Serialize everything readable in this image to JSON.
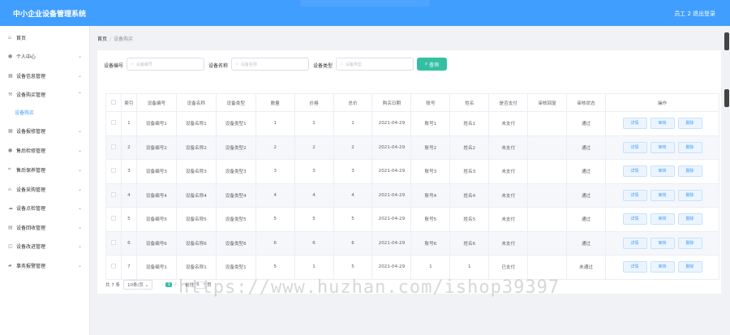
{
  "header": {
    "title": "中小企业设备管理系统",
    "user": "员工 2",
    "logout": "退出登录"
  },
  "sidebar": {
    "items": [
      {
        "label": "首页",
        "icon": "home-icon"
      },
      {
        "label": "个人中心",
        "icon": "user-icon"
      },
      {
        "label": "设备信息管理",
        "icon": "grid-icon"
      },
      {
        "label": "设备购买管理",
        "icon": "hammer-icon"
      },
      {
        "label": "设备购买",
        "icon": ""
      },
      {
        "label": "设备报修管理",
        "icon": "grid-icon"
      },
      {
        "label": "售后检修管理",
        "icon": "user-icon"
      },
      {
        "label": "售后保养管理",
        "icon": "crop-icon"
      },
      {
        "label": "设备采购管理",
        "icon": "bank-icon"
      },
      {
        "label": "设备点检管理",
        "icon": "cloud-icon"
      },
      {
        "label": "设备回收管理",
        "icon": "document-icon"
      },
      {
        "label": "设备改进管理",
        "icon": "chart-icon"
      },
      {
        "label": "事务报警管理",
        "icon": "folder-icon"
      }
    ]
  },
  "breadcrumb": {
    "home": "首页",
    "separator": "/",
    "current": "设备购买"
  },
  "search": {
    "fields": [
      {
        "label": "设备编号",
        "placeholder": "设备编号"
      },
      {
        "label": "设备名称",
        "placeholder": "设备名称"
      },
      {
        "label": "设备类型",
        "placeholder": "设备类型"
      }
    ],
    "button": "查询"
  },
  "table": {
    "headers": [
      "索引",
      "设备编号",
      "设备名称",
      "设备类型",
      "数量",
      "价格",
      "总价",
      "购买日期",
      "账号",
      "姓名",
      "是否支付",
      "审核回复",
      "审核状态",
      "操作"
    ],
    "rows": [
      [
        "1",
        "设备编号1",
        "设备名称1",
        "设备类型1",
        "1",
        "1",
        "1",
        "2021-04-29",
        "账号1",
        "姓名1",
        "未支付",
        "",
        "通过"
      ],
      [
        "2",
        "设备编号2",
        "设备名称2",
        "设备类型2",
        "2",
        "2",
        "2",
        "2021-04-29",
        "账号2",
        "姓名2",
        "未支付",
        "",
        "通过"
      ],
      [
        "3",
        "设备编号3",
        "设备名称3",
        "设备类型3",
        "3",
        "3",
        "3",
        "2021-04-29",
        "账号3",
        "姓名3",
        "未支付",
        "",
        "通过"
      ],
      [
        "4",
        "设备编号4",
        "设备名称4",
        "设备类型4",
        "4",
        "4",
        "4",
        "2021-04-29",
        "账号4",
        "姓名4",
        "未支付",
        "",
        "通过"
      ],
      [
        "5",
        "设备编号5",
        "设备名称5",
        "设备类型5",
        "5",
        "5",
        "5",
        "2021-04-29",
        "账号5",
        "姓名5",
        "未支付",
        "",
        "通过"
      ],
      [
        "6",
        "设备编号6",
        "设备名称6",
        "设备类型6",
        "6",
        "6",
        "6",
        "2021-04-29",
        "账号6",
        "姓名6",
        "未支付",
        "",
        "通过"
      ],
      [
        "7",
        "设备编号1",
        "设备名称1",
        "设备类型1",
        "5",
        "1",
        "5",
        "2021-04-29",
        "1",
        "1",
        "已支付",
        "",
        "未通过"
      ]
    ],
    "actions": [
      "详情",
      "审核",
      "删除"
    ]
  },
  "pagination": {
    "total": "共 7 条",
    "page_size": "10条/页",
    "pages": [
      "1",
      "2"
    ],
    "current_page": "1",
    "goto": "前往",
    "goto_value": "1",
    "page_unit": "页"
  },
  "watermark": "https://www.huzhan.com/ishop39397",
  "colors": {
    "primary": "#409eff",
    "accent": "#34bfa3"
  }
}
